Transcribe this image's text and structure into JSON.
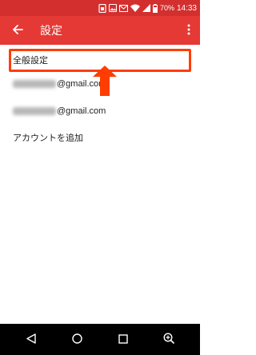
{
  "status_bar": {
    "time": "14:33",
    "battery": "70%",
    "icons": [
      "sim-icon",
      "photo-icon",
      "gmail-icon",
      "wifi-icon",
      "signal-icon",
      "battery-icon"
    ]
  },
  "app_bar": {
    "title": "設定",
    "back_icon": "arrow-left-icon",
    "overflow_icon": "more-vert-icon"
  },
  "menu": {
    "general": "全般設定",
    "accounts": [
      {
        "email_suffix": "@gmail.com"
      },
      {
        "email_suffix": "@gmail.com"
      }
    ],
    "add_account": "アカウントを追加"
  },
  "annotation": {
    "highlight_color": "#ff3d00",
    "arrow_color": "#ff3d00"
  },
  "colors": {
    "status_bar": "#d32f2f",
    "app_bar": "#e53935",
    "nav_bar": "#000000"
  },
  "nav_bar": {
    "icons": [
      "back-triangle-icon",
      "home-circle-icon",
      "recents-square-icon",
      "zoom-icon"
    ]
  }
}
